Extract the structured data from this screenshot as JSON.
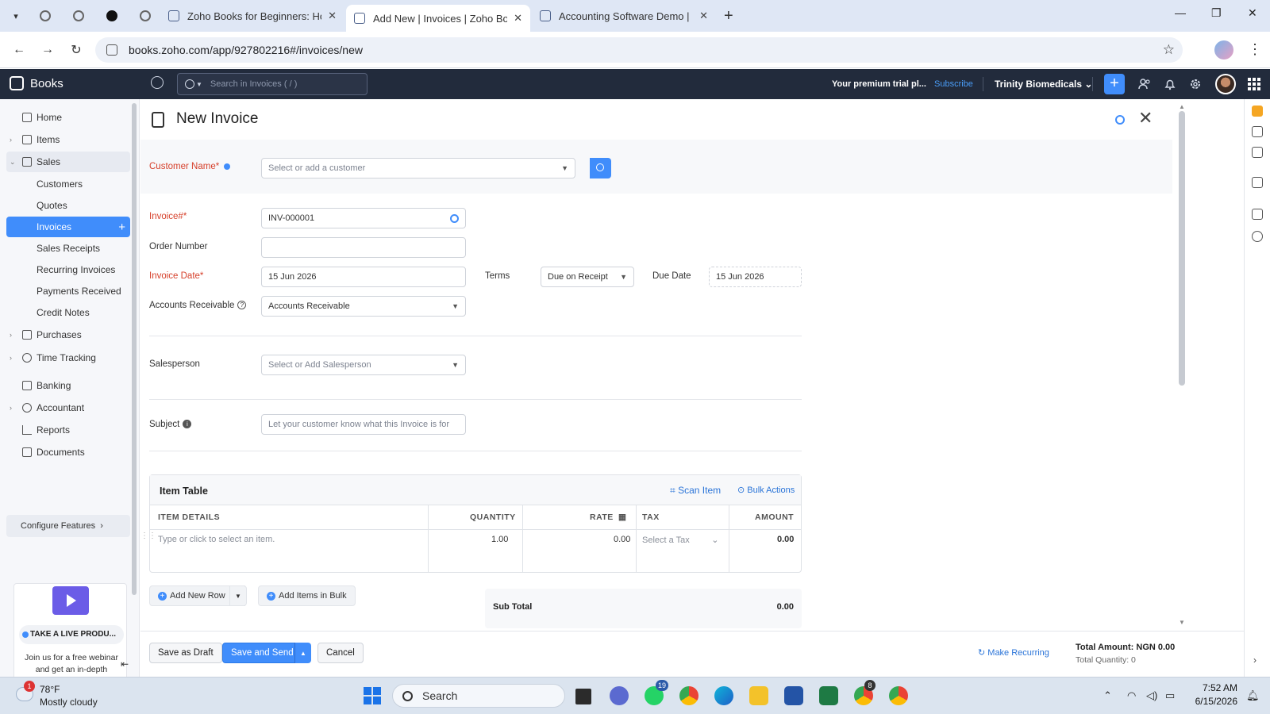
{
  "browser": {
    "tabs": [
      {
        "title": "Zoho Books for Beginners: How",
        "active": false
      },
      {
        "title": "Add New | Invoices | Zoho Book",
        "active": true
      },
      {
        "title": "Accounting Software Demo | Fr",
        "active": false
      }
    ],
    "url": "books.zoho.com/app/927802216#/invoices/new"
  },
  "header": {
    "app_name": "Books",
    "search_placeholder": "Search in Invoices ( / )",
    "trial_text": "Your premium trial pl...",
    "subscribe_label": "Subscribe",
    "org_name": "Trinity Biomedicals",
    "add_label": "+"
  },
  "sidebar": {
    "home": "Home",
    "items": "Items",
    "sales": "Sales",
    "sales_sub": [
      "Customers",
      "Quotes",
      "Invoices",
      "Sales Receipts",
      "Recurring Invoices",
      "Payments Received",
      "Credit Notes"
    ],
    "purchases": "Purchases",
    "time_tracking": "Time Tracking",
    "banking": "Banking",
    "accountant": "Accountant",
    "reports": "Reports",
    "documents": "Documents",
    "configure": "Configure Features",
    "promo_title": "TAKE A LIVE PRODU...",
    "promo_text": "Join us for a free webinar and get an in-depth overview of Zoho Books"
  },
  "form": {
    "title": "New Invoice",
    "customer_label": "Customer Name*",
    "customer_placeholder": "Select or add a customer",
    "invoice_no_label": "Invoice#*",
    "invoice_no_value": "INV-000001",
    "order_number_label": "Order Number",
    "order_number_value": "",
    "invoice_date_label": "Invoice Date*",
    "invoice_date_value": "15 Jun 2026",
    "terms_label": "Terms",
    "terms_value": "Due on Receipt",
    "due_date_label": "Due Date",
    "due_date_value": "15 Jun 2026",
    "ar_label": "Accounts Receivable",
    "ar_value": "Accounts Receivable",
    "salesperson_label": "Salesperson",
    "salesperson_placeholder": "Select or Add Salesperson",
    "subject_label": "Subject",
    "subject_placeholder": "Let your customer know what this Invoice is for"
  },
  "item_table": {
    "title": "Item Table",
    "scan_label": "Scan Item",
    "bulk_label": "Bulk Actions",
    "columns": [
      "ITEM DETAILS",
      "QUANTITY",
      "RATE",
      "TAX",
      "AMOUNT"
    ],
    "row": {
      "item_placeholder": "Type or click to select an item.",
      "quantity": "1.00",
      "rate": "0.00",
      "tax_placeholder": "Select a Tax",
      "amount": "0.00"
    },
    "add_row_label": "Add New Row",
    "add_bulk_label": "Add Items in Bulk",
    "subtotal_label": "Sub Total",
    "subtotal_value": "0.00"
  },
  "actions": {
    "save_draft": "Save as Draft",
    "save_send": "Save and Send",
    "cancel": "Cancel",
    "make_recurring": "Make Recurring",
    "total_amount": "Total Amount: NGN 0.00",
    "total_quantity": "Total Quantity: 0"
  },
  "taskbar": {
    "temperature": "78°F",
    "condition": "Mostly cloudy",
    "weather_badge": "1",
    "search_label": "Search",
    "whatsapp_badge": "19",
    "chrome_badge": "8",
    "time": "7:52 AM",
    "date": "6/15/2026"
  }
}
